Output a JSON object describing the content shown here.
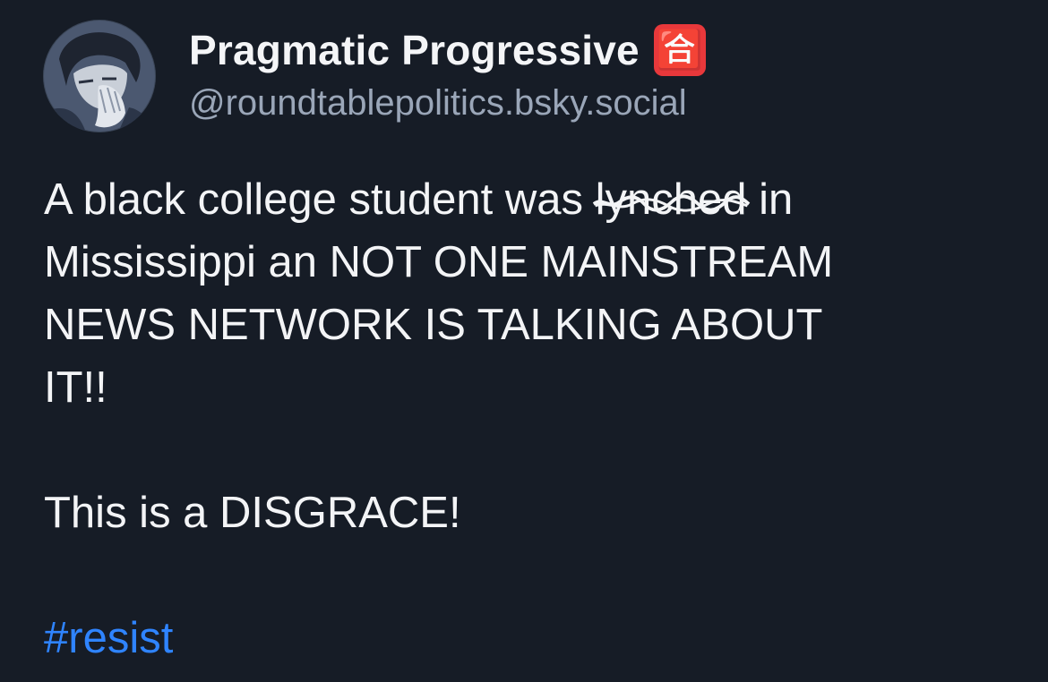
{
  "author": {
    "display_name": "Pragmatic Progressive",
    "name_emoji": "🈴",
    "name_emoji_icon": "japanese-passing-grade-icon",
    "handle": "@roundtablepolitics.bsky.social"
  },
  "post": {
    "line1_before_strike": "A black college student was ",
    "struck_word": "lynched",
    "line1_after_strike": " in",
    "line2": "Mississippi an NOT ONE MAINSTREAM",
    "line3": "NEWS NETWORK IS TALKING ABOUT",
    "line4": "IT!!",
    "paragraph2": "This is a DISGRACE!",
    "hashtag": "#resist"
  },
  "colors": {
    "background": "#161c26",
    "text": "#f3f4f6",
    "handle": "#9aa6b8",
    "hashtag": "#2f84ff",
    "emoji_badge": "#e8383b"
  }
}
